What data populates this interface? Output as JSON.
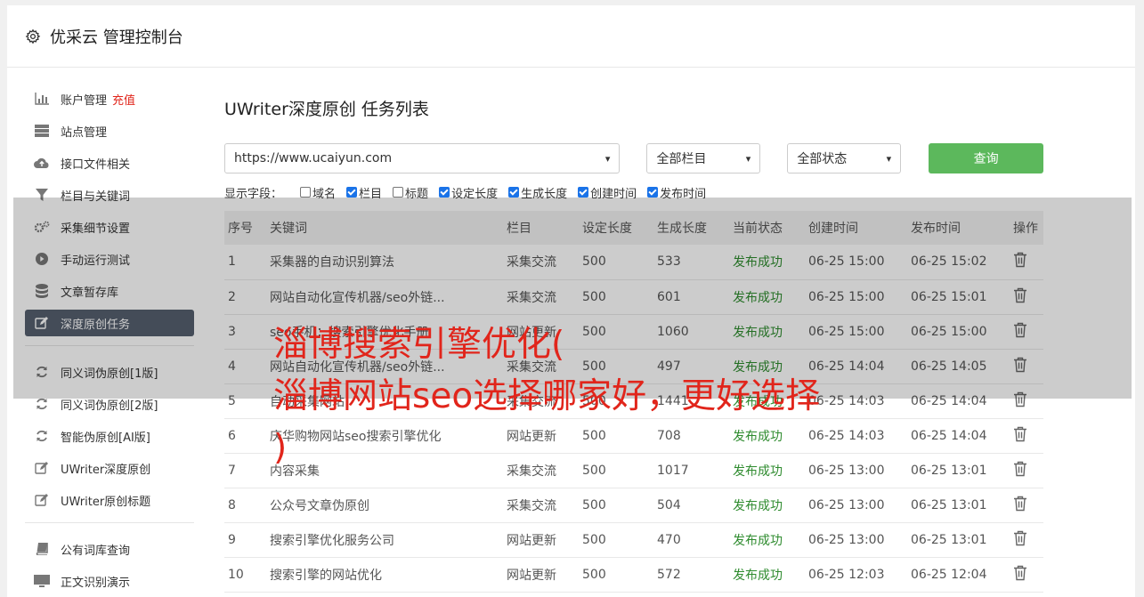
{
  "header": {
    "title": "优采云 管理控制台"
  },
  "sidebar": {
    "recharge": "充值",
    "groups": [
      [
        {
          "label": "账户管理",
          "icon": "bar-chart-icon"
        },
        {
          "label": "站点管理",
          "icon": "server-icon"
        },
        {
          "label": "接口文件相关",
          "icon": "cloud-upload-icon"
        },
        {
          "label": "栏目与关键词",
          "icon": "filter-icon"
        },
        {
          "label": "采集细节设置",
          "icon": "cogs-icon"
        },
        {
          "label": "手动运行测试",
          "icon": "play-icon"
        },
        {
          "label": "文章暂存库",
          "icon": "database-icon"
        },
        {
          "label": "深度原创任务",
          "icon": "edit-icon",
          "active": true
        }
      ],
      [
        {
          "label": "同义词伪原创[1版]",
          "icon": "refresh-icon"
        },
        {
          "label": "同义词伪原创[2版]",
          "icon": "refresh-icon"
        },
        {
          "label": "智能伪原创[AI版]",
          "icon": "refresh-icon"
        },
        {
          "label": "UWriter深度原创",
          "icon": "edit-icon"
        },
        {
          "label": "UWriter原创标题",
          "icon": "edit-icon"
        }
      ],
      [
        {
          "label": "公有词库查询",
          "icon": "book-icon"
        },
        {
          "label": "正文识别演示",
          "icon": "monitor-icon"
        }
      ]
    ]
  },
  "main": {
    "title": "UWriter深度原创 任务列表",
    "site_select": "https://www.ucaiyun.com",
    "column_select": "全部栏目",
    "status_select": "全部状态",
    "search_label": "查询",
    "fields_label": "显示字段：",
    "fields": [
      {
        "label": "域名",
        "checked": false
      },
      {
        "label": "栏目",
        "checked": true
      },
      {
        "label": "标题",
        "checked": false
      },
      {
        "label": "设定长度",
        "checked": true
      },
      {
        "label": "生成长度",
        "checked": true
      },
      {
        "label": "创建时间",
        "checked": true
      },
      {
        "label": "发布时间",
        "checked": true
      }
    ],
    "columns": [
      "序号",
      "关键词",
      "栏目",
      "设定长度",
      "生成长度",
      "当前状态",
      "创建时间",
      "发布时间",
      "操作"
    ],
    "rows": [
      [
        "1",
        "采集器的自动识别算法",
        "采集交流",
        "500",
        "533",
        "发布成功",
        "06-25 15:00",
        "06-25 15:02"
      ],
      [
        "2",
        "网站自动化宣传机器/seo外链...",
        "采集交流",
        "500",
        "601",
        "发布成功",
        "06-25 15:00",
        "06-25 15:01"
      ],
      [
        "3",
        "seo手机：搜索引擎优化手册",
        "网站更新",
        "500",
        "1060",
        "发布成功",
        "06-25 15:00",
        "06-25 15:00"
      ],
      [
        "4",
        "网站自动化宣传机器/seo外链...",
        "采集交流",
        "500",
        "497",
        "发布成功",
        "06-25 14:04",
        "06-25 14:05"
      ],
      [
        "5",
        "自动采集网站",
        "采集交流",
        "500",
        "1441",
        "发布成功",
        "06-25 14:03",
        "06-25 14:04"
      ],
      [
        "6",
        "庆华购物网站seo搜索引擎优化",
        "网站更新",
        "500",
        "708",
        "发布成功",
        "06-25 14:03",
        "06-25 14:04"
      ],
      [
        "7",
        "内容采集",
        "采集交流",
        "500",
        "1017",
        "发布成功",
        "06-25 13:00",
        "06-25 13:01"
      ],
      [
        "8",
        "公众号文章伪原创",
        "采集交流",
        "500",
        "504",
        "发布成功",
        "06-25 13:00",
        "06-25 13:01"
      ],
      [
        "9",
        "搜索引擎优化服务公司",
        "网站更新",
        "500",
        "470",
        "发布成功",
        "06-25 13:00",
        "06-25 13:01"
      ],
      [
        "10",
        "搜索引擎的网站优化",
        "网站更新",
        "500",
        "572",
        "发布成功",
        "06-25 12:03",
        "06-25 12:04"
      ]
    ]
  },
  "overlay_text": {
    "line1": "淄博搜索引擎优化(",
    "line2": "淄博网站seo选择哪家好，更好选择",
    "line3": ")"
  }
}
